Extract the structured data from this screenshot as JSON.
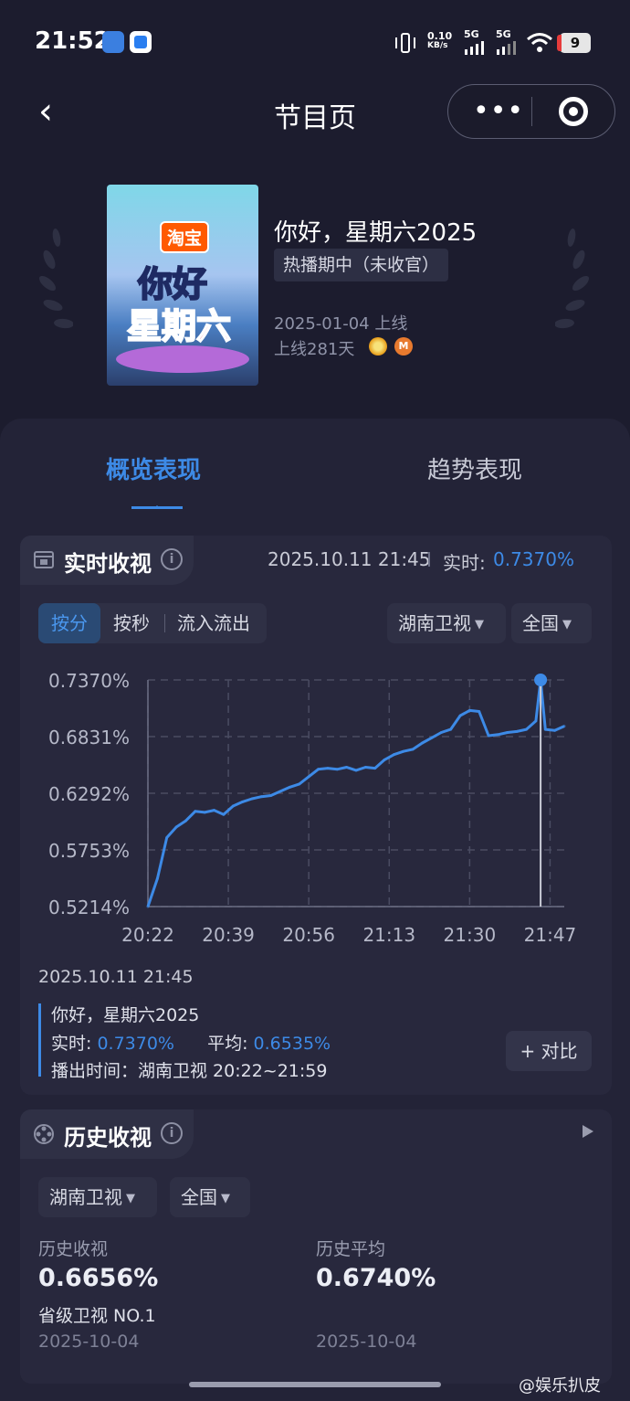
{
  "status_bar": {
    "time": "21:52",
    "net_speed": "0.10",
    "net_unit": "KB/s",
    "sig1": "5G",
    "sig2": "5G",
    "battery": "9"
  },
  "nav": {
    "back": "‹",
    "title": "节目页",
    "more_icon": "more-dots-icon",
    "close_icon": "target-icon"
  },
  "show": {
    "poster_brand": "淘宝",
    "poster_logo_line1": "你好",
    "poster_logo_line2": "星期六",
    "title": "你好，星期六2025",
    "status": "热播期中（未收官）",
    "release": "2025-01-04 上线",
    "days_online": "上线281天"
  },
  "tabs": [
    {
      "label": "概览表现",
      "active": true
    },
    {
      "label": "趋势表现",
      "active": false
    }
  ],
  "realtime": {
    "title": "实时收视",
    "timestamp": "2025.10.11 21:45",
    "live_label": "实时:",
    "live_value": "0.7370%",
    "segments": [
      "按分",
      "按秒",
      "流入流出"
    ],
    "channel": "湖南卫视",
    "region": "全国",
    "selected_time": "2025.10.11 21:45",
    "series_name": "你好，星期六2025",
    "live_text": "实时:",
    "avg_label": "平均:",
    "avg_value": "0.6535%",
    "airtime": "播出时间：湖南卫视 20:22~21:59",
    "compare": "+ 对比"
  },
  "chart_data": {
    "type": "line",
    "y_ticks": [
      "0.7370%",
      "0.6831%",
      "0.6292%",
      "0.5753%",
      "0.5214%"
    ],
    "x_ticks": [
      "20:22",
      "20:39",
      "20:56",
      "21:13",
      "21:30",
      "21:47"
    ],
    "ylim": [
      0.5214,
      0.737
    ],
    "xlim": [
      "20:22",
      "21:50"
    ],
    "grid": true,
    "highlight": {
      "x": "21:45",
      "y": 0.737
    },
    "series": [
      {
        "x": [
          "20:22",
          "20:24",
          "20:26",
          "20:28",
          "20:30",
          "20:32",
          "20:34",
          "20:36",
          "20:38",
          "20:40",
          "20:42",
          "20:44",
          "20:46",
          "20:48",
          "20:50",
          "20:52",
          "20:54",
          "20:56",
          "20:58",
          "21:00",
          "21:02",
          "21:04",
          "21:06",
          "21:08",
          "21:10",
          "21:12",
          "21:14",
          "21:16",
          "21:18",
          "21:20",
          "21:22",
          "21:24",
          "21:26",
          "21:28",
          "21:30",
          "21:32",
          "21:34",
          "21:36",
          "21:38",
          "21:40",
          "21:42",
          "21:44",
          "21:45",
          "21:46",
          "21:48",
          "21:50"
        ],
        "values": [
          0.5214,
          0.548,
          0.587,
          0.597,
          0.603,
          0.612,
          0.611,
          0.613,
          0.609,
          0.617,
          0.621,
          0.624,
          0.626,
          0.627,
          0.631,
          0.635,
          0.638,
          0.645,
          0.652,
          0.653,
          0.652,
          0.654,
          0.651,
          0.654,
          0.653,
          0.661,
          0.666,
          0.669,
          0.671,
          0.677,
          0.682,
          0.687,
          0.69,
          0.703,
          0.708,
          0.707,
          0.684,
          0.685,
          0.687,
          0.688,
          0.69,
          0.698,
          0.737,
          0.69,
          0.689,
          0.693
        ]
      }
    ]
  },
  "history": {
    "title": "历史收视",
    "channel": "湖南卫视",
    "region": "全国",
    "left_label": "历史收视",
    "left_value": "0.6656%",
    "left_note": "省级卫视 NO.1",
    "left_date": "2025-10-04",
    "right_label": "历史平均",
    "right_value": "0.6740%",
    "right_date": "2025-10-04"
  },
  "watermark": "@娱乐扒皮"
}
